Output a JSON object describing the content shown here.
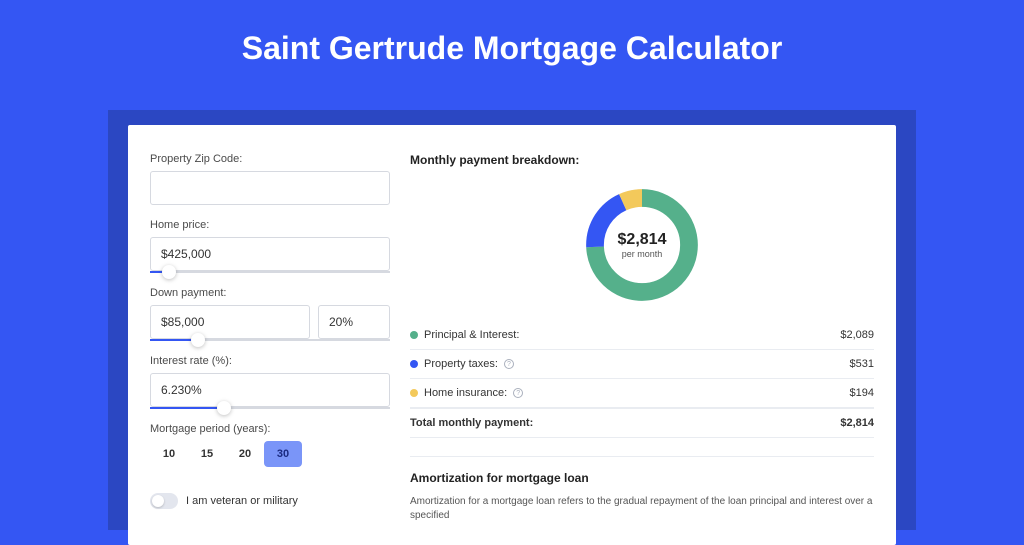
{
  "title": "Saint Gertrude Mortgage Calculator",
  "form": {
    "zip_label": "Property Zip Code:",
    "zip_value": "",
    "price_label": "Home price:",
    "price_value": "$425,000",
    "price_slider_pct": 8,
    "down_label": "Down payment:",
    "down_value": "$85,000",
    "down_pct_value": "20%",
    "down_slider_pct": 20,
    "rate_label": "Interest rate (%):",
    "rate_value": "6.230%",
    "rate_slider_pct": 31,
    "period_label": "Mortgage period (years):",
    "periods": [
      "10",
      "15",
      "20",
      "30"
    ],
    "period_active": 3,
    "veteran_label": "I am veteran or military",
    "veteran_on": false
  },
  "breakdown": {
    "heading": "Monthly payment breakdown:",
    "donut_value": "$2,814",
    "donut_sub": "per month",
    "items": [
      {
        "label": "Principal & Interest:",
        "value": "$2,089",
        "color": "#55b08b"
      },
      {
        "label": "Property taxes:",
        "value": "$531",
        "color": "#3456f3",
        "info": true
      },
      {
        "label": "Home insurance:",
        "value": "$194",
        "color": "#f3c95b",
        "info": true
      }
    ],
    "total_label": "Total monthly payment:",
    "total_value": "$2,814"
  },
  "chart_data": {
    "type": "pie",
    "title": "Monthly payment breakdown",
    "series": [
      {
        "name": "Principal & Interest",
        "value": 2089,
        "color": "#55b08b"
      },
      {
        "name": "Property taxes",
        "value": 531,
        "color": "#3456f3"
      },
      {
        "name": "Home insurance",
        "value": 194,
        "color": "#f3c95b"
      }
    ],
    "total": 2814,
    "center_label": "$2,814 per month"
  },
  "amortization": {
    "heading": "Amortization for mortgage loan",
    "body": "Amortization for a mortgage loan refers to the gradual repayment of the loan principal and interest over a specified"
  }
}
